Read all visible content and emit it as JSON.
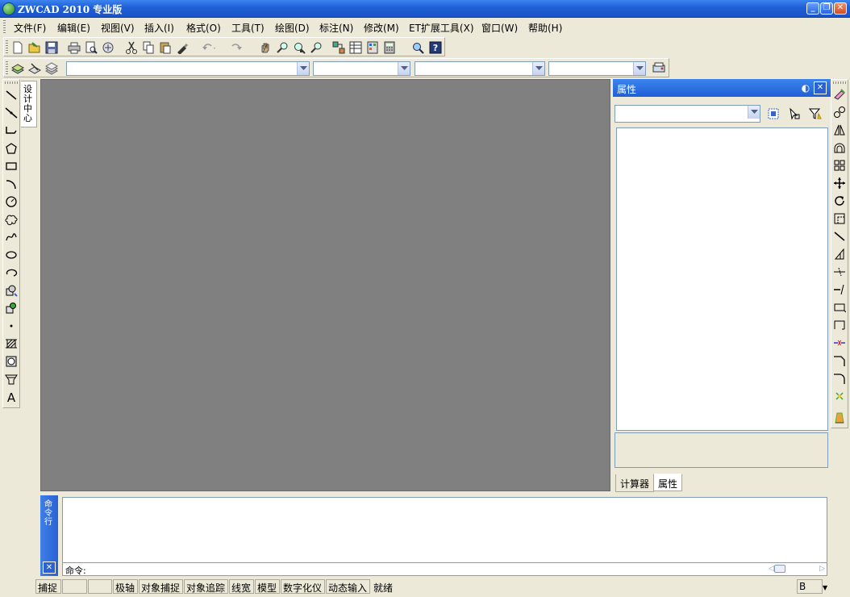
{
  "app": {
    "title": "ZWCAD 2010 专业版"
  },
  "window_controls": {
    "minimize": "_",
    "restore": "❐",
    "close": "✕"
  },
  "menu": [
    {
      "id": "file",
      "label": "文件(F)"
    },
    {
      "id": "edit",
      "label": "编辑(E)"
    },
    {
      "id": "view",
      "label": "视图(V)"
    },
    {
      "id": "insert",
      "label": "插入(I)"
    },
    {
      "id": "format",
      "label": "格式(O)"
    },
    {
      "id": "tools",
      "label": "工具(T)"
    },
    {
      "id": "draw",
      "label": "绘图(D)"
    },
    {
      "id": "dimension",
      "label": "标注(N)"
    },
    {
      "id": "modify",
      "label": "修改(M)"
    },
    {
      "id": "et",
      "label": "ET扩展工具(X)"
    },
    {
      "id": "window",
      "label": "窗口(W)"
    },
    {
      "id": "help",
      "label": "帮助(H)"
    }
  ],
  "toolbar_standard": [
    "new-file-icon",
    "open-file-icon",
    "save-icon",
    "print-icon",
    "print-preview-icon",
    "publish-icon",
    "cut-icon",
    "copy-icon",
    "paste-icon",
    "match-properties-icon",
    "undo-icon",
    "redo-icon",
    "pan-icon",
    "zoom-realtime-icon",
    "zoom-window-icon",
    "zoom-previous-icon",
    "design-center-icon",
    "properties-palette-icon",
    "tool-palette-icon",
    "calculator-icon",
    "find-icon",
    "help-icon"
  ],
  "toolbar_layers": {
    "layer_value": "",
    "color_value": "",
    "linetype_value": "",
    "lineweight_value": "",
    "icons": [
      "layer-manager-icon",
      "layer-previous-icon",
      "layer-states-icon",
      "plot-style-icon"
    ]
  },
  "draw_toolbar": [
    "line-icon",
    "construction-line-icon",
    "polyline-icon",
    "polygon-icon",
    "rectangle-icon",
    "arc-icon",
    "circle-icon",
    "revision-cloud-icon",
    "spline-icon",
    "ellipse-icon",
    "ellipse-arc-icon",
    "insert-block-icon",
    "make-block-icon",
    "point-icon",
    "hatch-icon",
    "region-icon",
    "table-icon",
    "text-icon"
  ],
  "left_tab": {
    "label": "设计中心"
  },
  "modify_toolbar": [
    "erase-icon",
    "copy-object-icon",
    "mirror-icon",
    "offset-icon",
    "array-icon",
    "move-icon",
    "rotate-icon",
    "scale-icon",
    "stretch-icon",
    "lengthen-icon",
    "trim-icon",
    "extend-icon",
    "break-at-point-icon",
    "break-icon",
    "join-icon",
    "chamfer-icon",
    "fillet-icon",
    "explode-icon",
    "eraser-tool-icon"
  ],
  "properties": {
    "title": "属性",
    "selection_value": "",
    "tabs": [
      {
        "label": "计算器",
        "active": false
      },
      {
        "label": "属性",
        "active": true
      }
    ]
  },
  "command": {
    "side_label": "命令行",
    "prompt": "命令:",
    "history": ""
  },
  "status": {
    "items": [
      "捕捉",
      "",
      "",
      "极轴",
      "对象捕捉",
      "对象追踪",
      "线宽",
      "模型",
      "数字化仪",
      "动态输入",
      "就绪"
    ],
    "right": "B"
  },
  "colors": {
    "title_bar": "#1f5fd6",
    "canvas": "#808080",
    "chrome": "#ece9d8",
    "panel_header": "#2a62d4"
  }
}
